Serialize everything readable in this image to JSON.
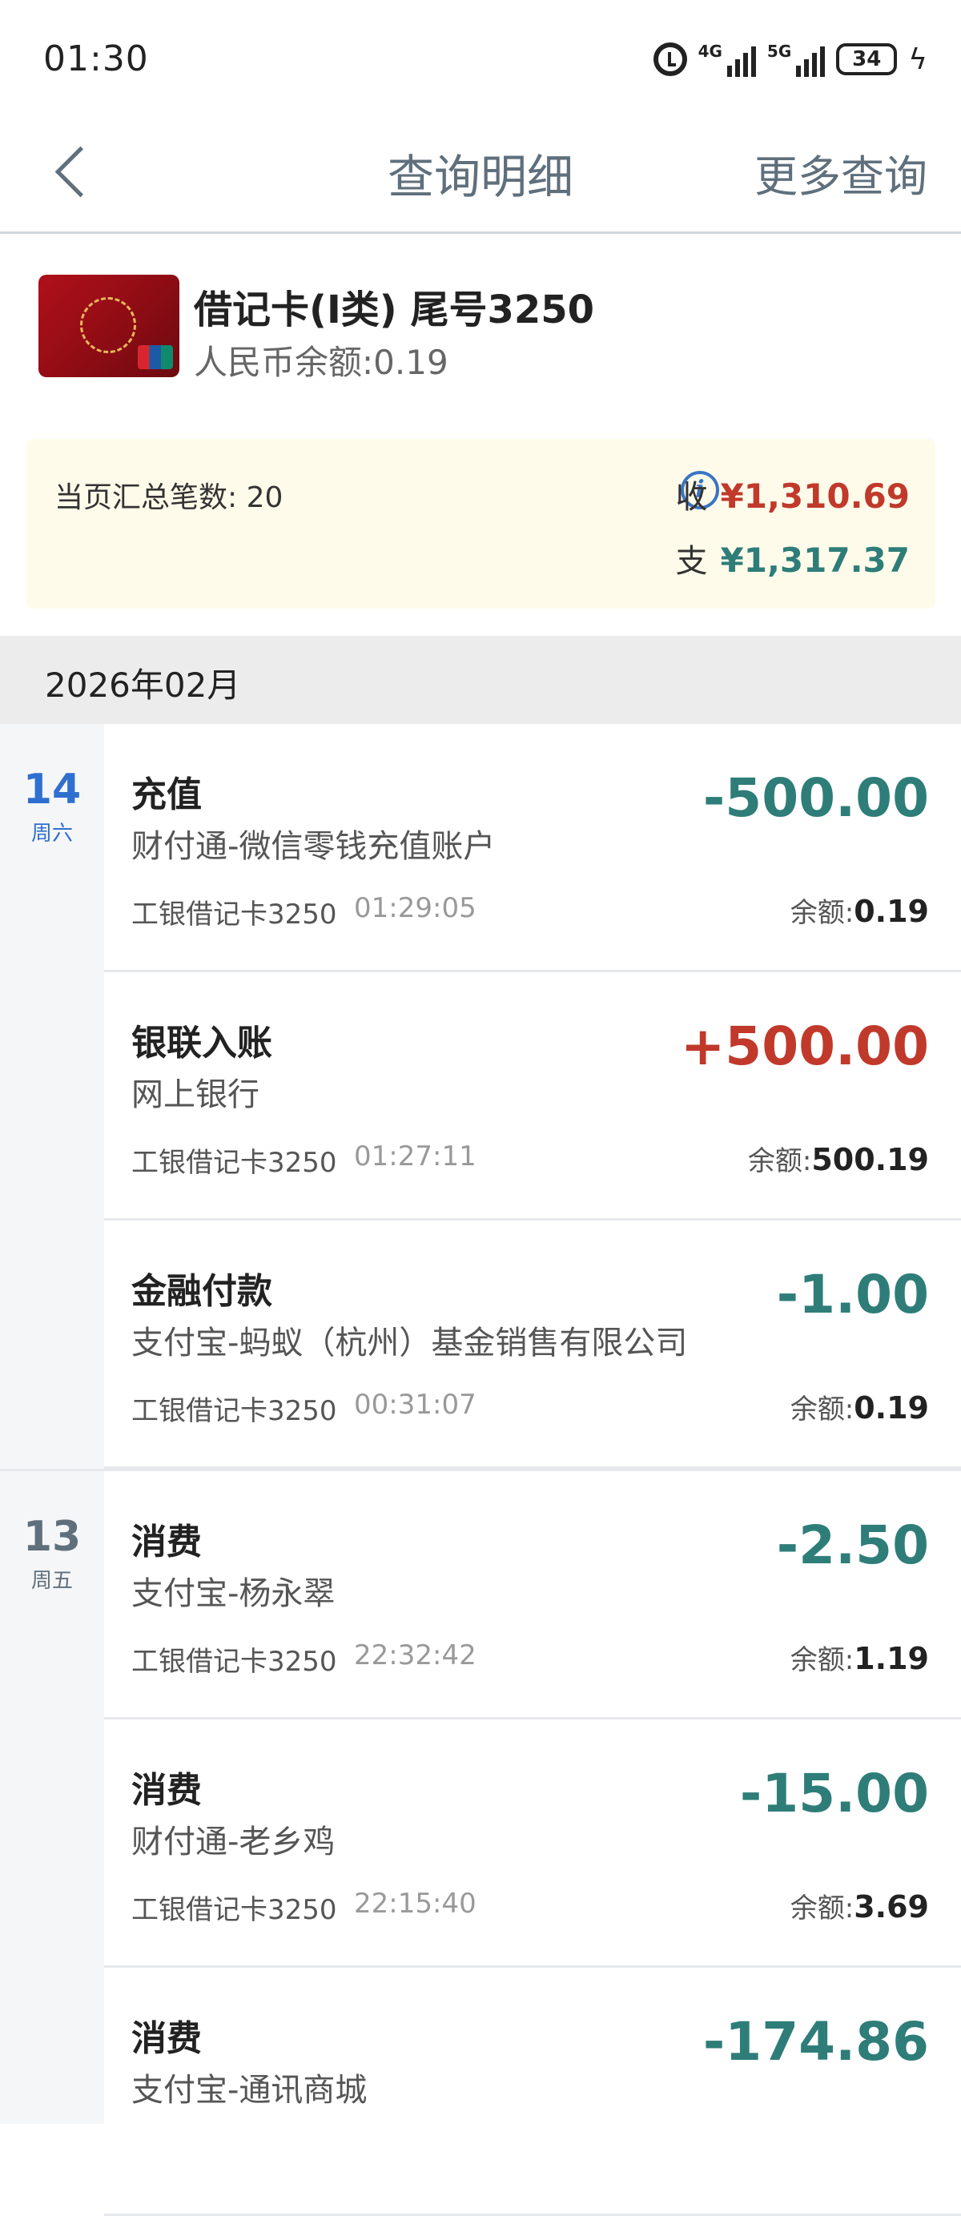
{
  "status_bar": {
    "time": "01:30",
    "net1": "4G",
    "net2": "5G",
    "battery": "34"
  },
  "header": {
    "title": "查询明细",
    "more_label": "更多查询"
  },
  "card": {
    "name": "借记卡(I类) 尾号3250",
    "balance": "人民币余额:0.19"
  },
  "summary": {
    "count_text": "当页汇总笔数: 20",
    "income_label": "收",
    "income_amount": "¥1,310.69",
    "expense_label": "支",
    "expense_amount": "¥1,317.37"
  },
  "month": "2026年02月",
  "days": [
    {
      "day": "14",
      "weekday": "周六",
      "txns": [
        {
          "type": "充值",
          "party": "财付通-微信零钱充值账户",
          "card": "工银借记卡3250",
          "time": "01:29:05",
          "amount": "-500.00",
          "dir": "out",
          "bal_label": "余额:",
          "balance": "0.19"
        },
        {
          "type": "银联入账",
          "party": "网上银行",
          "card": "工银借记卡3250",
          "time": "01:27:11",
          "amount": "+500.00",
          "dir": "in",
          "bal_label": "余额:",
          "balance": "500.19"
        },
        {
          "type": "金融付款",
          "party": "支付宝-蚂蚁（杭州）基金销售有限公司",
          "card": "工银借记卡3250",
          "time": "00:31:07",
          "amount": "-1.00",
          "dir": "out",
          "bal_label": "余额:",
          "balance": "0.19"
        }
      ]
    },
    {
      "day": "13",
      "weekday": "周五",
      "txns": [
        {
          "type": "消费",
          "party": "支付宝-杨永翠",
          "card": "工银借记卡3250",
          "time": "22:32:42",
          "amount": "-2.50",
          "dir": "out",
          "bal_label": "余额:",
          "balance": "1.19"
        },
        {
          "type": "消费",
          "party": "财付通-老乡鸡",
          "card": "工银借记卡3250",
          "time": "22:15:40",
          "amount": "-15.00",
          "dir": "out",
          "bal_label": "余额:",
          "balance": "3.69"
        },
        {
          "type": "消费",
          "party": "支付宝-通讯商城",
          "card": "",
          "time": "",
          "amount": "-174.86",
          "dir": "out",
          "bal_label": "",
          "balance": ""
        }
      ]
    }
  ],
  "colors": {
    "income": "#c0392b",
    "expense": "#2e7d78",
    "today": "#2f6fd0"
  }
}
